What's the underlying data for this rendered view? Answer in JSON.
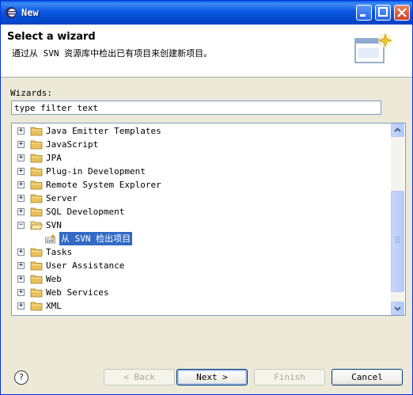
{
  "window": {
    "title": "New"
  },
  "header": {
    "title": "Select a wizard",
    "description": "通过从 SVN 资源库中检出已有项目来创建新项目。"
  },
  "filter": {
    "label": "Wizards:",
    "placeholder": "type filter text"
  },
  "tree": {
    "items": [
      {
        "label": "Java Emitter Templates",
        "expanded": false
      },
      {
        "label": "JavaScript",
        "expanded": false
      },
      {
        "label": "JPA",
        "expanded": false
      },
      {
        "label": "Plug-in Development",
        "expanded": false
      },
      {
        "label": "Remote System Explorer",
        "expanded": false
      },
      {
        "label": "Server",
        "expanded": false
      },
      {
        "label": "SQL Development",
        "expanded": false
      },
      {
        "label": "SVN",
        "expanded": true
      },
      {
        "label": "从 SVN 检出项目",
        "child": true,
        "selected": true
      },
      {
        "label": "Tasks",
        "expanded": false
      },
      {
        "label": "User Assistance",
        "expanded": false
      },
      {
        "label": "Web",
        "expanded": false
      },
      {
        "label": "Web Services",
        "expanded": false
      },
      {
        "label": "XML",
        "expanded": false
      }
    ]
  },
  "buttons": {
    "help": "?",
    "back": "< Back",
    "next": "Next >",
    "finish": "Finish",
    "cancel": "Cancel"
  },
  "colors": {
    "titlebar": "#0a58e0",
    "selection": "#316ac5",
    "folder": "#e9c05b"
  },
  "icons": {
    "folder": "folder-icon",
    "expand": "plus-icon",
    "collapse": "minus-icon",
    "svn": "svn-checkout-icon"
  }
}
